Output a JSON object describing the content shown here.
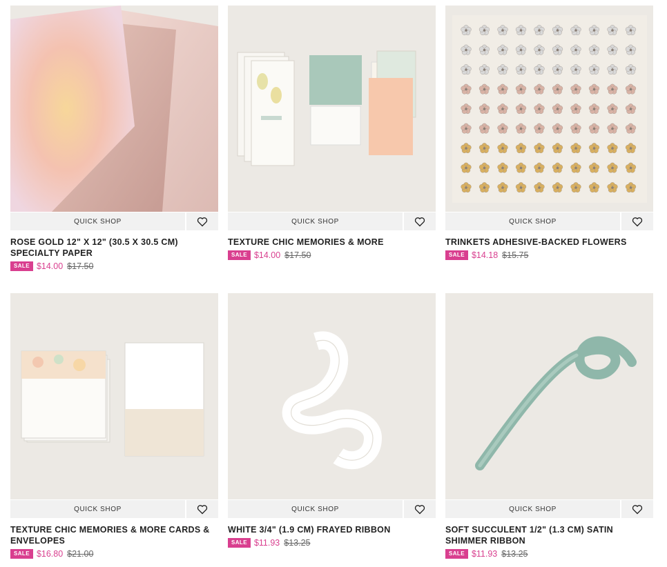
{
  "products": [
    {
      "title": "Rose Gold 12\" x 12\" (30.5 x 30.5 cm) Specialty Paper",
      "sale_badge": "SALE",
      "sale_price": "$14.00",
      "regular_price": "$17.50",
      "quick_shop_label": "QUICK SHOP"
    },
    {
      "title": "Texture Chic Memories & More",
      "sale_badge": "SALE",
      "sale_price": "$14.00",
      "regular_price": "$17.50",
      "quick_shop_label": "QUICK SHOP"
    },
    {
      "title": "Trinkets Adhesive-Backed Flowers",
      "sale_badge": "SALE",
      "sale_price": "$14.18",
      "regular_price": "$15.75",
      "quick_shop_label": "QUICK SHOP"
    },
    {
      "title": "Texture Chic Memories & More Cards & Envelopes",
      "sale_badge": "SALE",
      "sale_price": "$16.80",
      "regular_price": "$21.00",
      "quick_shop_label": "QUICK SHOP"
    },
    {
      "title": "White 3/4\" (1.9 cm) Frayed Ribbon",
      "sale_badge": "SALE",
      "sale_price": "$11.93",
      "regular_price": "$13.25",
      "quick_shop_label": "QUICK SHOP"
    },
    {
      "title": "Soft Succulent 1/2\" (1.3 cm) Satin Shimmer Ribbon",
      "sale_badge": "SALE",
      "sale_price": "$11.93",
      "regular_price": "$13.25",
      "quick_shop_label": "QUICK SHOP"
    }
  ],
  "colors": {
    "sale": "#d93f8f",
    "image_bg": "#ece9e4",
    "button_bg": "#f1f1f1"
  },
  "icons": {
    "favorite": "heart-icon"
  }
}
